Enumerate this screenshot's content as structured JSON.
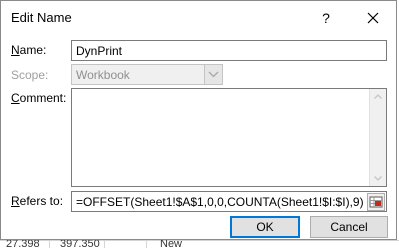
{
  "background": {
    "rows": [
      {
        "cells": [
          "27.398",
          "397.350",
          "New"
        ]
      }
    ]
  },
  "dialog": {
    "title": "Edit Name",
    "help_glyph": "?",
    "name": {
      "label_accel": "N",
      "label_rest": "ame:",
      "value": "DynPrint"
    },
    "scope": {
      "label": "Scope:",
      "value": "Workbook"
    },
    "comment": {
      "label_accel": "C",
      "label_rest": "omment:",
      "value": ""
    },
    "refers_to": {
      "label_accel": "R",
      "label_rest": "efers to:",
      "value": "=OFFSET(Sheet1!$A$1,0,0,COUNTA(Sheet1!$I:$I),9)"
    },
    "ok_label": "OK",
    "cancel_label": "Cancel"
  },
  "colors": {
    "accent": "#0078d7",
    "range_icon_red": "#c42b1c"
  },
  "icons": [
    "close-icon",
    "chevron-down-icon",
    "scroll-up-icon",
    "scroll-down-icon",
    "range-select-icon"
  ]
}
